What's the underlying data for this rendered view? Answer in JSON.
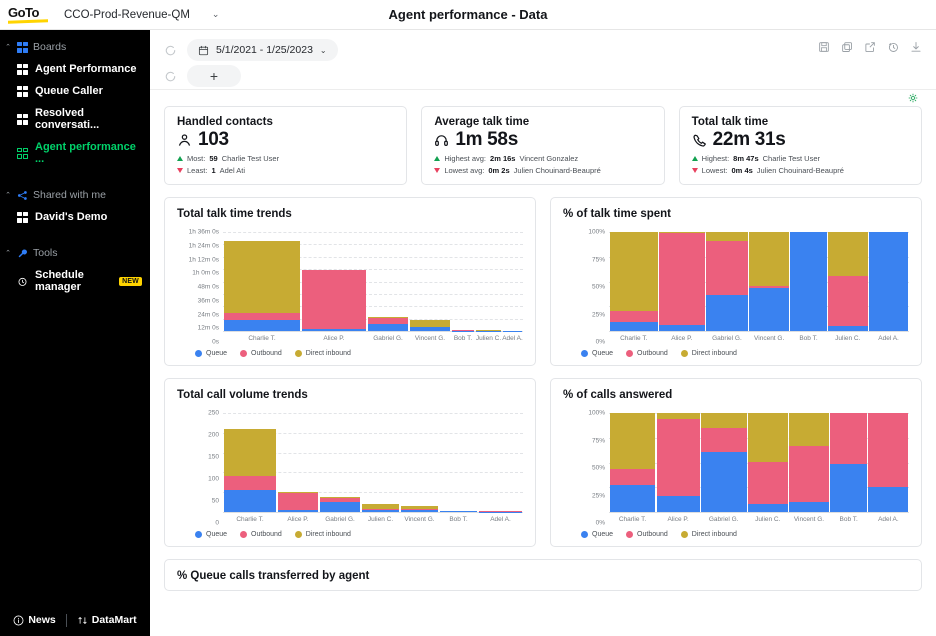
{
  "topbar": {
    "brand": "GoTo",
    "account": "CCO-Prod-Revenue-QM",
    "account_caret": "⌄",
    "page_title": "Agent performance - Data"
  },
  "sidebar": {
    "sections": [
      {
        "label": "Boards",
        "caret": "⌃",
        "icon": "boards-icon",
        "items": [
          {
            "label": "Agent Performance",
            "icon": "board-icon",
            "active": false
          },
          {
            "label": "Queue Caller",
            "icon": "board-icon",
            "active": false
          },
          {
            "label": "Resolved conversati...",
            "icon": "board-icon",
            "active": false
          },
          {
            "label": "Agent performance ...",
            "icon": "board-outline-icon",
            "active": true
          }
        ]
      },
      {
        "label": "Shared with me",
        "caret": "⌃",
        "icon": "share-nodes-icon",
        "items": [
          {
            "label": "David's Demo",
            "icon": "board-icon",
            "active": false
          }
        ]
      },
      {
        "label": "Tools",
        "caret": "⌃",
        "icon": "wrench-icon",
        "items": [
          {
            "label": "Schedule manager",
            "icon": "clock-icon",
            "active": false,
            "badge": "NEW"
          }
        ]
      }
    ],
    "footer": {
      "news": "News",
      "datamart": "DataMart"
    }
  },
  "toolbar": {
    "date_range": "5/1/2021 - 1/25/2023",
    "date_caret": "⌄",
    "add_label": "+",
    "icons": [
      "save-icon",
      "copy-icon",
      "export-icon",
      "history-icon",
      "download-icon"
    ]
  },
  "kpis": [
    {
      "title": "Handled contacts",
      "icon": "people-icon",
      "value": "103",
      "high_label": "Most:",
      "high_value": "59",
      "high_name": "Charlie Test User",
      "low_label": "Least:",
      "low_value": "1",
      "low_name": "Adel Ati"
    },
    {
      "title": "Average talk time",
      "icon": "headset-icon",
      "value": "1m 58s",
      "high_label": "Highest avg:",
      "high_value": "2m 16s",
      "high_name": "Vincent Gonzalez",
      "low_label": "Lowest avg:",
      "low_value": "0m 2s",
      "low_name": "Julien Chouinard-Beaupré"
    },
    {
      "title": "Total talk time",
      "icon": "phone-icon",
      "value": "22m 31s",
      "high_label": "Highest:",
      "high_value": "8m 47s",
      "high_name": "Charlie Test User",
      "low_label": "Lowest:",
      "low_value": "0m 4s",
      "low_name": "Julien Chouinard-Beaupré"
    }
  ],
  "legend": [
    {
      "label": "Queue",
      "color": "#3a82f0"
    },
    {
      "label": "Outbound",
      "color": "#ec5f7d"
    },
    {
      "label": "Direct inbound",
      "color": "#c7ab33"
    }
  ],
  "colors": {
    "queue": "#3a82f0",
    "outbound": "#ec5f7d",
    "direct_inbound": "#c7ab33",
    "accent_green": "#00d26a",
    "brand_yellow": "#ffd400",
    "up": "#12a150",
    "down": "#e8405e"
  },
  "bottom_card": {
    "title": "% Queue calls transferred by agent"
  },
  "chart_data": [
    {
      "id": "total-talk-time-trends",
      "type": "bar",
      "title": "Total talk time trends",
      "stacked": true,
      "variable_width": true,
      "categories": [
        "Charlie T.",
        "Alice P.",
        "Gabriel G.",
        "Vincent G.",
        "Bob T.",
        "Julien C.",
        "Adel A."
      ],
      "widths": [
        26,
        22,
        14,
        14,
        8,
        9,
        7
      ],
      "ytick_labels": [
        "1h 36m 0s",
        "1h 24m 0s",
        "1h 12m 0s",
        "1h 0m 0s",
        "48m 0s",
        "36m 0s",
        "24m 0s",
        "12m 0s",
        "0s"
      ],
      "ytick_values": [
        5760,
        5040,
        4320,
        3600,
        2880,
        2160,
        1440,
        720,
        0
      ],
      "ylim": [
        0,
        5760
      ],
      "ylabel": "",
      "xlabel": "",
      "grid": true,
      "legend_position": "bottom-left",
      "series": [
        {
          "name": "Queue",
          "color": "#3a82f0",
          "values": [
            660,
            120,
            390,
            210,
            30,
            12,
            10
          ]
        },
        {
          "name": "Outbound",
          "color": "#ec5f7d",
          "values": [
            360,
            3420,
            360,
            30,
            10,
            18,
            12
          ]
        },
        {
          "name": "Direct inbound",
          "color": "#c7ab33",
          "values": [
            4200,
            30,
            60,
            420,
            8,
            6,
            6
          ]
        }
      ]
    },
    {
      "id": "pct-of-talk-time-spent",
      "type": "bar",
      "title": "% of talk time spent",
      "stacked": true,
      "normalized": true,
      "variable_width": true,
      "categories": [
        "Charlie T.",
        "Alice P.",
        "Gabriel G.",
        "Vincent G.",
        "Bob T.",
        "Julien C.",
        "Adel A."
      ],
      "widths": [
        17,
        16,
        15,
        14,
        13,
        14,
        14
      ],
      "ytick_labels": [
        "100%",
        "75%",
        "50%",
        "25%",
        "0%"
      ],
      "ytick_values": [
        100,
        75,
        50,
        25,
        0
      ],
      "ylim": [
        0,
        100
      ],
      "grid": true,
      "legend_position": "bottom-left",
      "series": [
        {
          "name": "Queue",
          "color": "#3a82f0",
          "values": [
            9.5,
            6,
            36,
            43,
            100,
            5,
            100
          ]
        },
        {
          "name": "Outbound",
          "color": "#ec5f7d",
          "values": [
            11,
            93,
            55,
            2,
            0,
            51,
            0
          ]
        },
        {
          "name": "Direct inbound",
          "color": "#c7ab33",
          "values": [
            79.5,
            1,
            9,
            55,
            0,
            44,
            0
          ]
        }
      ]
    },
    {
      "id": "total-call-volume-trends",
      "type": "bar",
      "title": "Total call volume trends",
      "stacked": true,
      "variable_width": true,
      "categories": [
        "Charlie T.",
        "Alice P.",
        "Gabriel G.",
        "Julien C.",
        "Vincent G.",
        "Bob T.",
        "Adel A."
      ],
      "widths": [
        18,
        14,
        14,
        13,
        13,
        13,
        15
      ],
      "ytick_labels": [
        "250",
        "200",
        "150",
        "100",
        "50",
        "0"
      ],
      "ytick_values": [
        250,
        200,
        150,
        100,
        50,
        0
      ],
      "ylim": [
        0,
        250
      ],
      "grid": true,
      "legend_position": "bottom-left",
      "series": [
        {
          "name": "Queue",
          "color": "#3a82f0",
          "values": [
            56,
            6,
            26,
            5,
            4,
            2,
            1
          ]
        },
        {
          "name": "Outbound",
          "color": "#ec5f7d",
          "values": [
            35,
            42,
            9,
            3,
            3,
            1,
            2
          ]
        },
        {
          "name": "Direct inbound",
          "color": "#c7ab33",
          "values": [
            119,
            3,
            3,
            12,
            8,
            0,
            0
          ]
        }
      ]
    },
    {
      "id": "pct-of-calls-answered",
      "type": "bar",
      "title": "% of calls answered",
      "stacked": true,
      "normalized": true,
      "variable_width": true,
      "categories": [
        "Charlie T.",
        "Alice P.",
        "Gabriel G.",
        "Julien C.",
        "Vincent G.",
        "Bob T.",
        "Adel A."
      ],
      "widths": [
        16,
        15,
        16,
        14,
        14,
        13,
        14
      ],
      "ytick_labels": [
        "100%",
        "75%",
        "50%",
        "25%",
        "0%"
      ],
      "ytick_values": [
        100,
        75,
        50,
        25,
        0
      ],
      "ylim": [
        0,
        100
      ],
      "grid": true,
      "legend_position": "bottom-left",
      "series": [
        {
          "name": "Queue",
          "color": "#3a82f0",
          "values": [
            27,
            16,
            61,
            8,
            10,
            49,
            25
          ]
        },
        {
          "name": "Outbound",
          "color": "#ec5f7d",
          "values": [
            16,
            78,
            24,
            43,
            57,
            51,
            75
          ]
        },
        {
          "name": "Direct inbound",
          "color": "#c7ab33",
          "values": [
            57,
            6,
            15,
            49,
            33,
            0,
            0
          ]
        }
      ]
    }
  ]
}
